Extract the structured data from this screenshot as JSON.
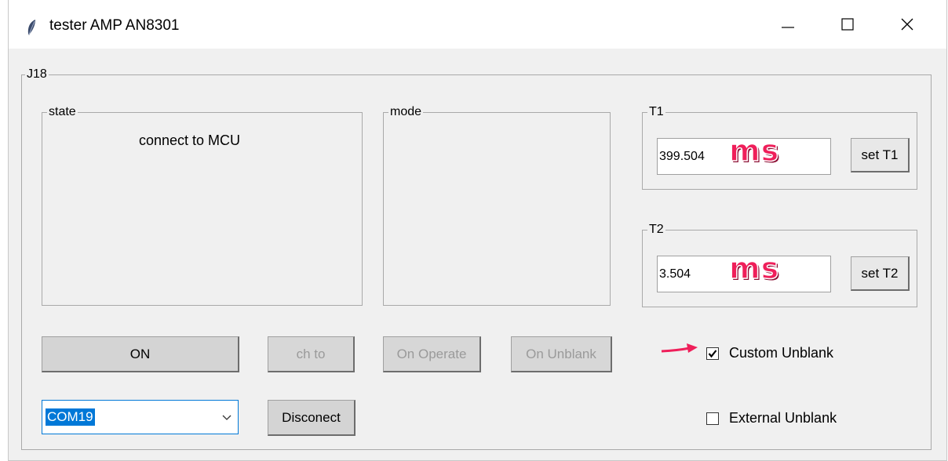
{
  "window": {
    "title": "tester AMP AN8301",
    "icon": "feather-icon",
    "controls": [
      "minimize-icon",
      "maximize-icon",
      "close-icon"
    ]
  },
  "main_group": {
    "label": "J18"
  },
  "state": {
    "label": "state",
    "text": "connect to MCU"
  },
  "mode": {
    "label": "mode"
  },
  "t1": {
    "label": "T1",
    "value": "399.504",
    "unit": "ms",
    "button": "set T1"
  },
  "t2": {
    "label": "T2",
    "value": "3.504",
    "unit": "ms",
    "button": "set T2"
  },
  "buttons": {
    "on": "ON",
    "ch_to": "ch to",
    "on_operate": "On Operate",
    "on_unblank": "On Unblank",
    "disconnect": "Disconect"
  },
  "port": {
    "selected": "COM19"
  },
  "checkboxes": {
    "custom_unblank": {
      "label": "Custom Unblank",
      "checked": true
    },
    "external_unblank": {
      "label": "External Unblank",
      "checked": false
    }
  },
  "colors": {
    "annotation": "#ef1f5a",
    "selection": "#0078d7"
  }
}
